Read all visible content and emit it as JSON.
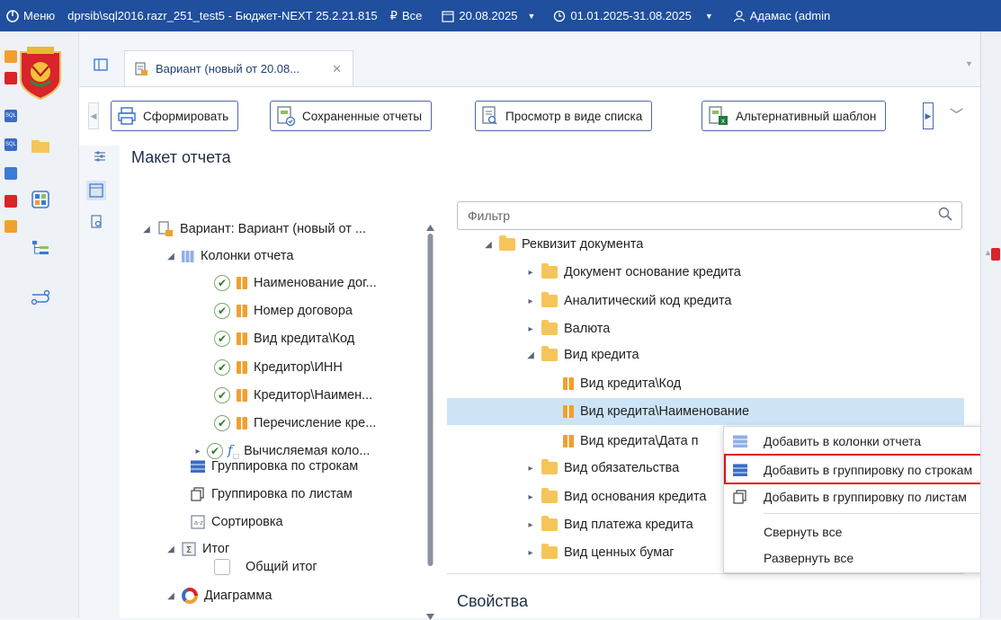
{
  "titlebar": {
    "menu_label": "Меню",
    "connection": "dprsib\\sql2016.razr_251_test5 - Бюджет-NEXT 25.2.21.815",
    "currency_filter": "Все",
    "date": "20.08.2025",
    "period": "01.01.2025-31.08.2025",
    "user": "Адамас (admin"
  },
  "tab": {
    "label": "Вариант (новый от 20.08...",
    "close": "✕"
  },
  "toolbar": {
    "form_label": "Сформировать",
    "saved_label": "Сохраненные отчеты",
    "list_view_label": "Просмотр в виде списка",
    "alt_template_label": "Альтернативный шаблон"
  },
  "section_title": "Макет отчета",
  "left_tree": [
    {
      "label": "Вариант: Вариант (новый от ...",
      "arrow": "◢",
      "icon": "variant-icon"
    },
    {
      "label": "Колонки отчета",
      "arrow": "◢",
      "icon": "columns-icon"
    },
    {
      "label": "Наименование дог...",
      "icon": "column-icon",
      "checked": true
    },
    {
      "label": "Номер договора",
      "icon": "column-icon",
      "checked": true
    },
    {
      "label": "Вид кредита\\Код",
      "icon": "column-icon",
      "checked": true
    },
    {
      "label": "Кредитор\\ИНН",
      "icon": "column-icon",
      "checked": true
    },
    {
      "label": "Кредитор\\Наимен...",
      "icon": "column-icon",
      "checked": true
    },
    {
      "label": "Перечисление кре...",
      "icon": "column-icon",
      "checked": true
    },
    {
      "label": "Вычисляемая коло...",
      "arrow": "▸",
      "icon": "function-icon",
      "checked": true
    },
    {
      "label": "Группировка по строкам",
      "icon": "row-grouping-icon"
    },
    {
      "label": "Группировка по листам",
      "icon": "sheet-grouping-icon"
    },
    {
      "label": "Сортировка",
      "icon": "sort-icon"
    },
    {
      "label": "Итог",
      "arrow": "◢",
      "icon": "sum-icon"
    },
    {
      "label": "Общий итог",
      "checked": false
    },
    {
      "label": "Диаграмма",
      "arrow": "◢",
      "icon": "chart-icon"
    }
  ],
  "filter": {
    "placeholder": "Фильтр"
  },
  "right_tree": [
    {
      "label": "Реквизит документа",
      "arrow": "◢",
      "icon": "folder-icon"
    },
    {
      "label": "Документ основание кредита",
      "arrow": "▸",
      "icon": "folder-icon"
    },
    {
      "label": "Аналитический код кредита",
      "arrow": "▸",
      "icon": "folder-icon"
    },
    {
      "label": "Валюта",
      "arrow": "▸",
      "icon": "folder-icon"
    },
    {
      "label": "Вид кредита",
      "arrow": "◢",
      "icon": "folder-icon"
    },
    {
      "label": "Вид кредита\\Код",
      "icon": "column-icon"
    },
    {
      "label": "Вид кредита\\Наименование",
      "icon": "column-icon",
      "selected": true
    },
    {
      "label": "Вид кредита\\Дата п",
      "icon": "column-icon"
    },
    {
      "label": "Вид обязательства",
      "arrow": "▸",
      "icon": "folder-icon"
    },
    {
      "label": "Вид основания кредита",
      "arrow": "▸",
      "icon": "folder-icon"
    },
    {
      "label": "Вид платежа кредита",
      "arrow": "▸",
      "icon": "folder-icon"
    },
    {
      "label": "Вид ценных бумаг",
      "arrow": "▸",
      "icon": "folder-icon"
    }
  ],
  "context_menu": {
    "items": [
      {
        "label": "Добавить в колонки отчета",
        "icon": "grid-icon"
      },
      {
        "label": "Добавить в группировку по строкам",
        "icon": "grid-icon",
        "highlighted": true
      },
      {
        "label": "Добавить в группировку по листам",
        "icon": "sheet-icon"
      },
      {
        "label": "Свернуть все"
      },
      {
        "label": "Развернуть все"
      }
    ]
  },
  "properties_title": "Свойства",
  "colors": {
    "titlebar": "#1f4f9d",
    "selection": "#cde4f7",
    "highlight_border": "#e01010",
    "toolbar_border": "#4b6aa8"
  }
}
